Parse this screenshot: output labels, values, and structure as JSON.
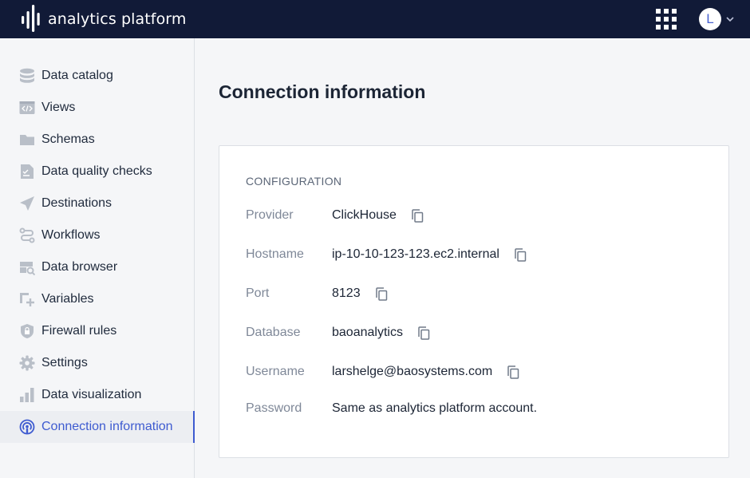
{
  "header": {
    "logo_text": "analytics platform",
    "apps_icon": "grid-icon",
    "user_initial": "L",
    "user_menu_icon": "chevron-down-icon"
  },
  "sidebar": {
    "items": [
      {
        "label": "Data catalog",
        "icon": "database-icon"
      },
      {
        "label": "Views",
        "icon": "code-icon"
      },
      {
        "label": "Schemas",
        "icon": "folder-icon"
      },
      {
        "label": "Data quality checks",
        "icon": "document-check-icon"
      },
      {
        "label": "Destinations",
        "icon": "send-icon"
      },
      {
        "label": "Workflows",
        "icon": "workflow-icon"
      },
      {
        "label": "Data browser",
        "icon": "search-table-icon"
      },
      {
        "label": "Variables",
        "icon": "add-variable-icon"
      },
      {
        "label": "Firewall rules",
        "icon": "shield-icon"
      },
      {
        "label": "Settings",
        "icon": "gear-icon"
      },
      {
        "label": "Data visualization",
        "icon": "bar-chart-icon"
      },
      {
        "label": "Connection information",
        "icon": "broadcast-icon",
        "active": true
      }
    ]
  },
  "main": {
    "title": "Connection information",
    "section_label": "CONFIGURATION",
    "fields": {
      "provider": {
        "key": "Provider",
        "value": "ClickHouse"
      },
      "hostname": {
        "key": "Hostname",
        "value": "ip-10-10-123-123.ec2.internal"
      },
      "port": {
        "key": "Port",
        "value": "8123"
      },
      "database": {
        "key": "Database",
        "value": "baoanalytics"
      },
      "username": {
        "key": "Username",
        "value": "larshelge@baosystems.com"
      },
      "password": {
        "key": "Password",
        "value": "Same as analytics platform account."
      }
    }
  },
  "colors": {
    "topbar": "#111a37",
    "accent": "#3e5bd0",
    "icon_gray": "#b9bfc8"
  }
}
